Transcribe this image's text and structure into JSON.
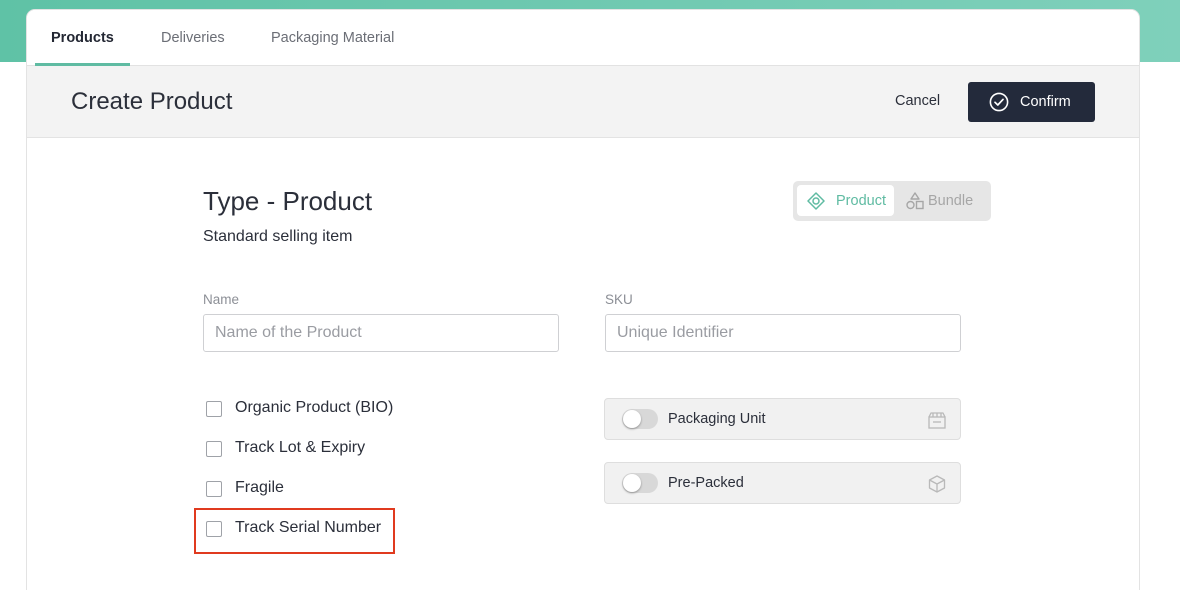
{
  "tabs": [
    {
      "label": "Products",
      "active": true
    },
    {
      "label": "Deliveries",
      "active": false
    },
    {
      "label": "Packaging Material",
      "active": false
    }
  ],
  "header": {
    "title": "Create Product",
    "cancel_label": "Cancel",
    "confirm_label": "Confirm"
  },
  "type_section": {
    "title": "Type - Product",
    "subtitle": "Standard selling item",
    "toggle": {
      "product_label": "Product",
      "bundle_label": "Bundle",
      "selected": "Product"
    }
  },
  "form": {
    "name": {
      "label": "Name",
      "placeholder": "Name of the Product",
      "value": ""
    },
    "sku": {
      "label": "SKU",
      "placeholder": "Unique Identifier",
      "value": ""
    }
  },
  "checkboxes": [
    {
      "label": "Organic Product (BIO)",
      "checked": false
    },
    {
      "label": "Track Lot & Expiry",
      "checked": false
    },
    {
      "label": "Fragile",
      "checked": false
    },
    {
      "label": "Track Serial Number",
      "checked": false
    }
  ],
  "toggles": [
    {
      "label": "Packaging Unit",
      "on": false,
      "icon": "package-box-icon"
    },
    {
      "label": "Pre-Packed",
      "on": false,
      "icon": "cube-icon"
    }
  ],
  "colors": {
    "accent": "#5fbba2",
    "confirm_bg": "#232a3b",
    "highlight": "#e03a1f"
  }
}
